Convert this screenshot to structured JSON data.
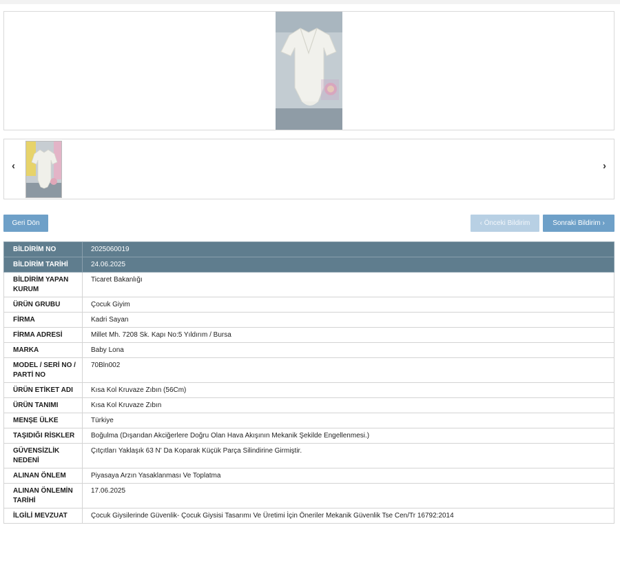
{
  "gallery": {
    "prev_arrow": "‹",
    "next_arrow": "›"
  },
  "nav": {
    "back_label": "Geri Dön",
    "prev_label": "‹ Önceki Bildirim",
    "next_label": "Sonraki Bildirim ›"
  },
  "details": [
    {
      "label": "BİLDİRİM NO",
      "value": "2025060019",
      "highlight": true
    },
    {
      "label": "BİLDİRİM TARİHİ",
      "value": "24.06.2025",
      "highlight": true
    },
    {
      "label": "BİLDİRİM YAPAN KURUM",
      "value": "Ticaret Bakanlığı"
    },
    {
      "label": "ÜRÜN GRUBU",
      "value": "Çocuk Giyim"
    },
    {
      "label": "FİRMA",
      "value": "Kadri Sayan"
    },
    {
      "label": "FİRMA ADRESİ",
      "value": "Millet Mh. 7208 Sk. Kapı No:5 Yıldırım / Bursa"
    },
    {
      "label": "MARKA",
      "value": "Baby Lona"
    },
    {
      "label": "MODEL / SERİ NO / PARTİ NO",
      "value": "70Bln002"
    },
    {
      "label": "ÜRÜN ETİKET ADI",
      "value": "Kısa Kol Kruvaze Zıbın (56Cm)"
    },
    {
      "label": "ÜRÜN TANIMI",
      "value": "Kısa Kol Kruvaze Zıbın"
    },
    {
      "label": "MENŞE ÜLKE",
      "value": "Türkiye"
    },
    {
      "label": "TAŞIDIĞI RİSKLER",
      "value": "Boğulma (Dışarıdan Akciğerlere Doğru Olan Hava Akışının Mekanik Şekilde Engellenmesi.)"
    },
    {
      "label": "GÜVENSİZLİK NEDENİ",
      "value": "Çıtçıtları Yaklaşık 63 N' Da Koparak Küçük Parça Silindirine Girmiştir."
    },
    {
      "label": "ALINAN ÖNLEM",
      "value": "Piyasaya Arzın Yasaklanması Ve Toplatma"
    },
    {
      "label": "ALINAN ÖNLEMİN TARİHİ",
      "value": "17.06.2025"
    },
    {
      "label": "İLGİLİ MEVZUAT",
      "value": "Çocuk Giysilerinde Güvenlik- Çocuk Giysisi Tasarımı Ve Üretimi İçin Öneriler Mekanik Güvenlik Tse Cen/Tr 16792:2014"
    }
  ]
}
